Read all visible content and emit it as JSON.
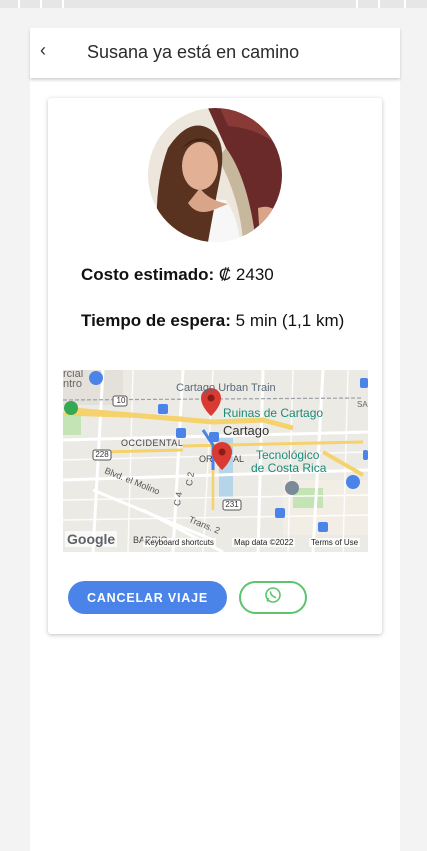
{
  "header": {
    "back_icon": "chevron-left-icon",
    "title": "Susana ya está en camino"
  },
  "driver": {
    "cost_label": "Costo estimado:",
    "cost_value": "₡ 2430",
    "wait_label": "Tiempo de espera:",
    "wait_value": "5 min (1,1 km)"
  },
  "map": {
    "labels": {
      "l1": "rcial",
      "l2": "ntro",
      "l3": "Cartago Urban Train",
      "l4": "Ruinas de Cartago",
      "l5": "Cartago",
      "l6": "OCCIDENTAL",
      "l7": "OR",
      "l8": "AL",
      "l9": "Tecnológico",
      "l10": "de Costa Rica",
      "l11": "Blvd. el Molino",
      "l12": "C 4",
      "l13": "C 2",
      "l14": "Trans. 2",
      "l15": "SA",
      "r10": "10",
      "r228": "228",
      "r231": "231"
    },
    "footer": {
      "logo": "Google",
      "barrio": "BARRIO",
      "shortcuts": "Keyboard shortcuts",
      "mapdata": "Map data ©2022",
      "terms": "Terms of Use"
    },
    "colors": {
      "road": "#f5d26b",
      "pin": "#d93a31",
      "water": "#b6d5e8",
      "park": "#c4e4b5"
    }
  },
  "actions": {
    "cancel_label": "CANCELAR VIAJE",
    "whatsapp_icon": "whatsapp-icon",
    "accent": "#4b84e8",
    "whatsapp_color": "#5cc46e"
  }
}
